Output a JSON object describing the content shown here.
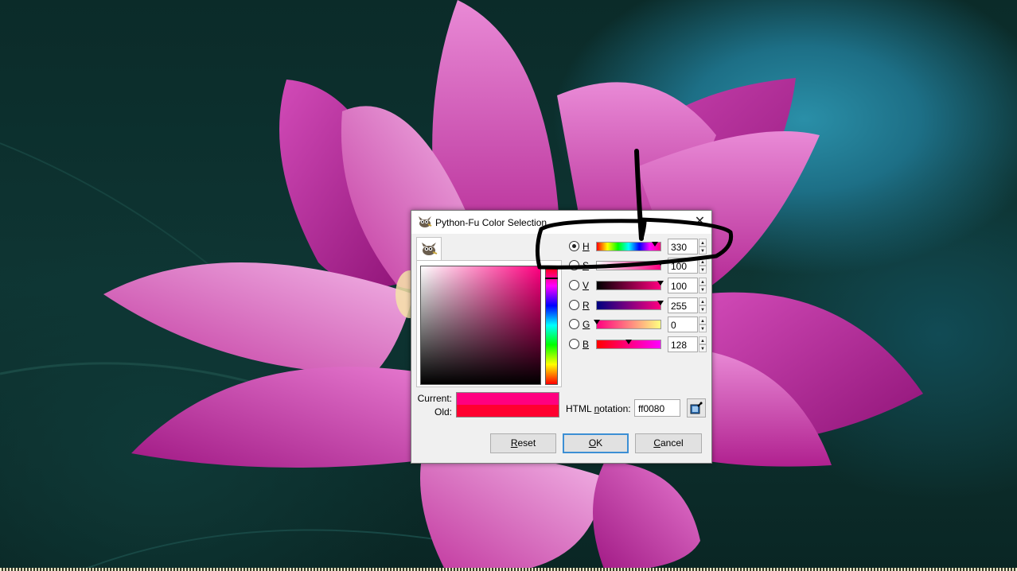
{
  "dialog": {
    "title": "Python-Fu Color Selection",
    "close_glyph": "✕",
    "tab_icon": "wilber-icon"
  },
  "channels": [
    {
      "key": "H",
      "value": "330",
      "checked": true,
      "marker_fraction": 0.917,
      "gradient": "linear-gradient(to right,#ff0000,#ffff00,#00ff00,#00ffff,#0000ff,#ff00ff,#ff0080)"
    },
    {
      "key": "S",
      "value": "100",
      "checked": false,
      "marker_fraction": 1.0,
      "gradient": "linear-gradient(to right,#ffffff,#ff0080)"
    },
    {
      "key": "V",
      "value": "100",
      "checked": false,
      "marker_fraction": 1.0,
      "gradient": "linear-gradient(to right,#000000,#ff0080)"
    },
    {
      "key": "R",
      "value": "255",
      "checked": false,
      "marker_fraction": 1.0,
      "gradient": "linear-gradient(to right,#000080,#ff0080)"
    },
    {
      "key": "G",
      "value": "0",
      "checked": false,
      "marker_fraction": 0.0,
      "gradient": "linear-gradient(to right,#ff0080,#ffff80)"
    },
    {
      "key": "B",
      "value": "128",
      "checked": false,
      "marker_fraction": 0.502,
      "gradient": "linear-gradient(to right,#ff0000,#ff00ff)"
    }
  ],
  "preview": {
    "current_label": "Current:",
    "old_label": "Old:",
    "current_color": "#ff0080",
    "old_color": "#ff0030"
  },
  "html_notation": {
    "label_prefix": "HTML ",
    "label_mnemonic": "n",
    "label_suffix": "otation:",
    "value": "ff0080"
  },
  "buttons": {
    "reset": {
      "mnemonic": "R",
      "rest": "eset"
    },
    "ok": {
      "mnemonic": "O",
      "rest": "K"
    },
    "cancel": {
      "mnemonic": "C",
      "rest": "ancel"
    }
  },
  "colors": {
    "hue_color": "#ff0080",
    "focus_border": "#3c8fd4",
    "annotation_ink": "#000000"
  }
}
